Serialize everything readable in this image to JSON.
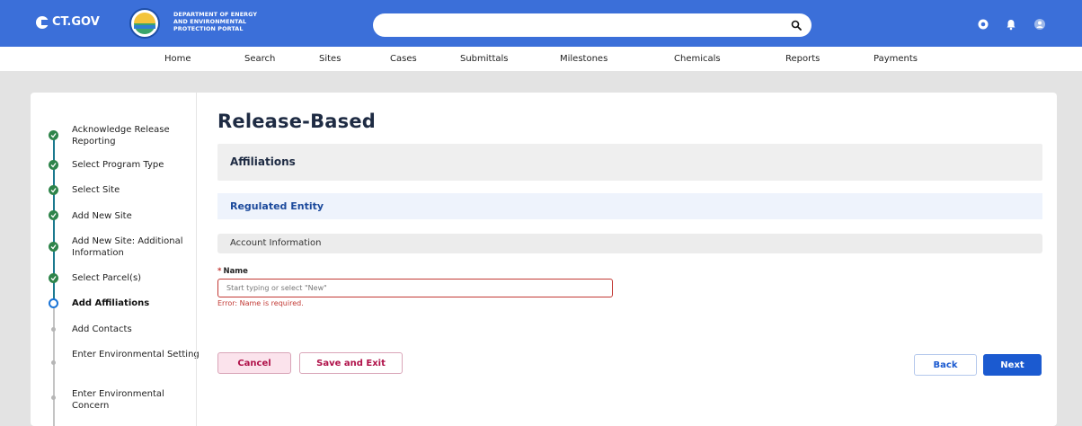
{
  "header": {
    "logo_text": "CT.GOV",
    "department_lines": [
      "DEPARTMENT OF ENERGY",
      "AND ENVIRONMENTAL",
      "PROTECTION PORTAL"
    ]
  },
  "nav": {
    "items": [
      "Home",
      "Search",
      "Sites",
      "Cases",
      "Submittals",
      "Milestones",
      "Chemicals",
      "Reports",
      "Payments"
    ]
  },
  "steps": [
    {
      "label": "Acknowledge Release Reporting",
      "status": "complete"
    },
    {
      "label": "Select Program Type",
      "status": "complete"
    },
    {
      "label": "Select Site",
      "status": "complete"
    },
    {
      "label": "Add New Site",
      "status": "complete"
    },
    {
      "label": "Add New Site: Additional Information",
      "status": "complete"
    },
    {
      "label": "Select Parcel(s)",
      "status": "complete"
    },
    {
      "label": "Add Affiliations",
      "status": "current"
    },
    {
      "label": "Add Contacts",
      "status": "incomplete"
    },
    {
      "label": "Enter Environmental Setting",
      "status": "incomplete"
    },
    {
      "label": "Enter Environmental Concern",
      "status": "incomplete"
    }
  ],
  "main": {
    "title": "Release-Based",
    "section_affiliations": "Affiliations",
    "section_regulated": "Regulated Entity",
    "section_account": "Account Information",
    "name_field": {
      "required_marker": "*",
      "label": "Name",
      "value": "",
      "placeholder": "Start typing or select \"New\"",
      "error": "Error: Name is required."
    },
    "buttons": {
      "cancel": "Cancel",
      "save_exit": "Save and Exit",
      "back": "Back",
      "next": "Next"
    }
  },
  "colors": {
    "header_bg": "#3b6fd9",
    "brand_blue": "#1b5ad0",
    "complete_green": "#2e844a",
    "error_red": "#c23934"
  }
}
